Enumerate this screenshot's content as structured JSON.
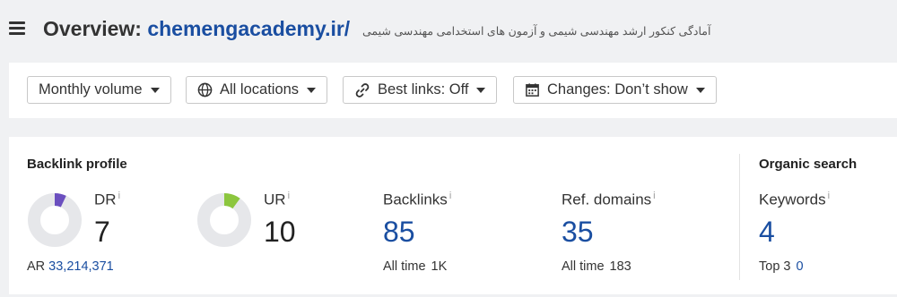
{
  "header": {
    "title_prefix": "Overview: ",
    "domain": "chemengacademy.ir/",
    "subtitle": "آمادگی کنکور ارشد مهندسی شیمی و آزمون های استخدامی مهندسی شیمی"
  },
  "filters": [
    {
      "label": "Monthly volume",
      "icon": ""
    },
    {
      "label": "All locations",
      "icon": "globe-icon"
    },
    {
      "label": "Best links: Off",
      "icon": "link-icon"
    },
    {
      "label": "Changes: Don’t show",
      "icon": "calendar-icon"
    }
  ],
  "backlink_profile": {
    "title": "Backlink profile",
    "dr": {
      "label": "DR",
      "info": "i",
      "value": "7",
      "gauge_fraction": 0.07,
      "gauge_color": "#6b4fbf"
    },
    "ur": {
      "label": "UR",
      "info": "i",
      "value": "10",
      "gauge_fraction": 0.1,
      "gauge_color": "#8cc63e"
    },
    "ar": {
      "label": "AR",
      "value": "33,214,371"
    },
    "backlinks": {
      "label": "Backlinks",
      "info": "i",
      "value": "85",
      "sub_label": "All time",
      "sub_value": "1K"
    },
    "ref_domains": {
      "label": "Ref. domains",
      "info": "i",
      "value": "35",
      "sub_label": "All time",
      "sub_value": "183"
    }
  },
  "organic_search": {
    "title": "Organic search",
    "keywords": {
      "label": "Keywords",
      "info": "i",
      "value": "4",
      "sub_label": "Top 3",
      "sub_value": "0"
    }
  },
  "colors": {
    "link": "#1a4ea1",
    "gauge_track": "#e6e7ea"
  }
}
